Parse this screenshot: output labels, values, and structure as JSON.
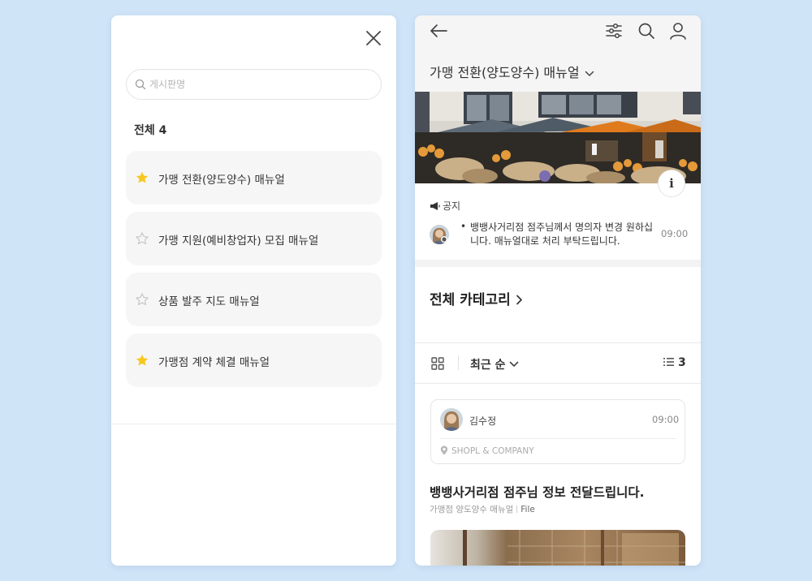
{
  "left_panel": {
    "search_placeholder": "게시판명",
    "all_label": "전체 4",
    "boards": [
      {
        "label": "가맹 전환(양도양수) 매뉴얼",
        "favorite": true
      },
      {
        "label": "가맹 지원(예비창업자) 모집 매뉴얼",
        "favorite": false
      },
      {
        "label": "상품 발주 지도 매뉴얼",
        "favorite": false
      },
      {
        "label": "가맹점 계약 체결 매뉴얼",
        "favorite": true
      }
    ]
  },
  "right_panel": {
    "board_title": "가맹 전환(양도양수) 매뉴얼",
    "notice": {
      "label": "공지",
      "bullet": "•",
      "text": "뱅뱅사거리점 점주님께서 명의자 변경 원하십니다. 매뉴얼대로 처리 부탁드립니다.",
      "time": "09:00"
    },
    "all_categories_label": "전체 카테고리",
    "sort_label": "최근 순",
    "list_count": "3",
    "post": {
      "author": "김수정",
      "time": "09:00",
      "company": "SHOPL & COMPANY",
      "title": "뱅뱅사거리점 점주님 정보 전달드립니다.",
      "board": "가맹점 양도양수 매뉴얼",
      "type": "File"
    }
  },
  "colors": {
    "background": "#cfe4f7",
    "star_active": "#f7c81e",
    "star_inactive": "#c4c4c4",
    "text_primary": "#222222"
  },
  "icons": {
    "close": "close-icon",
    "search": "search-icon",
    "star": "star-icon",
    "back": "back-arrow-icon",
    "filter": "filter-icon",
    "profile": "profile-icon",
    "info": "info-icon",
    "megaphone": "megaphone-icon",
    "grid": "grid-icon",
    "list": "list-icon",
    "location": "location-pin-icon"
  }
}
